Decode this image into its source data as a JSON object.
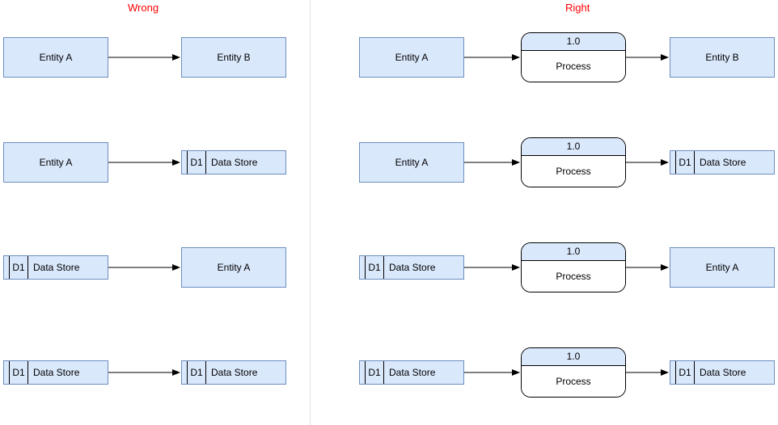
{
  "headings": {
    "wrong": "Wrong",
    "right": "Right"
  },
  "labels": {
    "entityA": "Entity A",
    "entityB": "Entity B",
    "dataStore": "Data Store",
    "dsId": "D1",
    "process": "Process",
    "processId": "1.0"
  },
  "diagram": {
    "description": "DFD miracle/black-hole rule illustration. Left column shows four invalid direct flows; right column shows same flows with a Process inserted between the endpoints.",
    "wrong_rows": [
      {
        "from": "Entity A",
        "to": "Entity B"
      },
      {
        "from": "Entity A",
        "to": "DataStore D1"
      },
      {
        "from": "DataStore D1",
        "to": "Entity A"
      },
      {
        "from": "DataStore D1",
        "to": "DataStore D1"
      }
    ],
    "right_rows": [
      {
        "from": "Entity A",
        "via": "Process 1.0",
        "to": "Entity B"
      },
      {
        "from": "Entity A",
        "via": "Process 1.0",
        "to": "DataStore D1"
      },
      {
        "from": "DataStore D1",
        "via": "Process 1.0",
        "to": "Entity A"
      },
      {
        "from": "DataStore D1",
        "via": "Process 1.0",
        "to": "DataStore D1"
      }
    ]
  }
}
